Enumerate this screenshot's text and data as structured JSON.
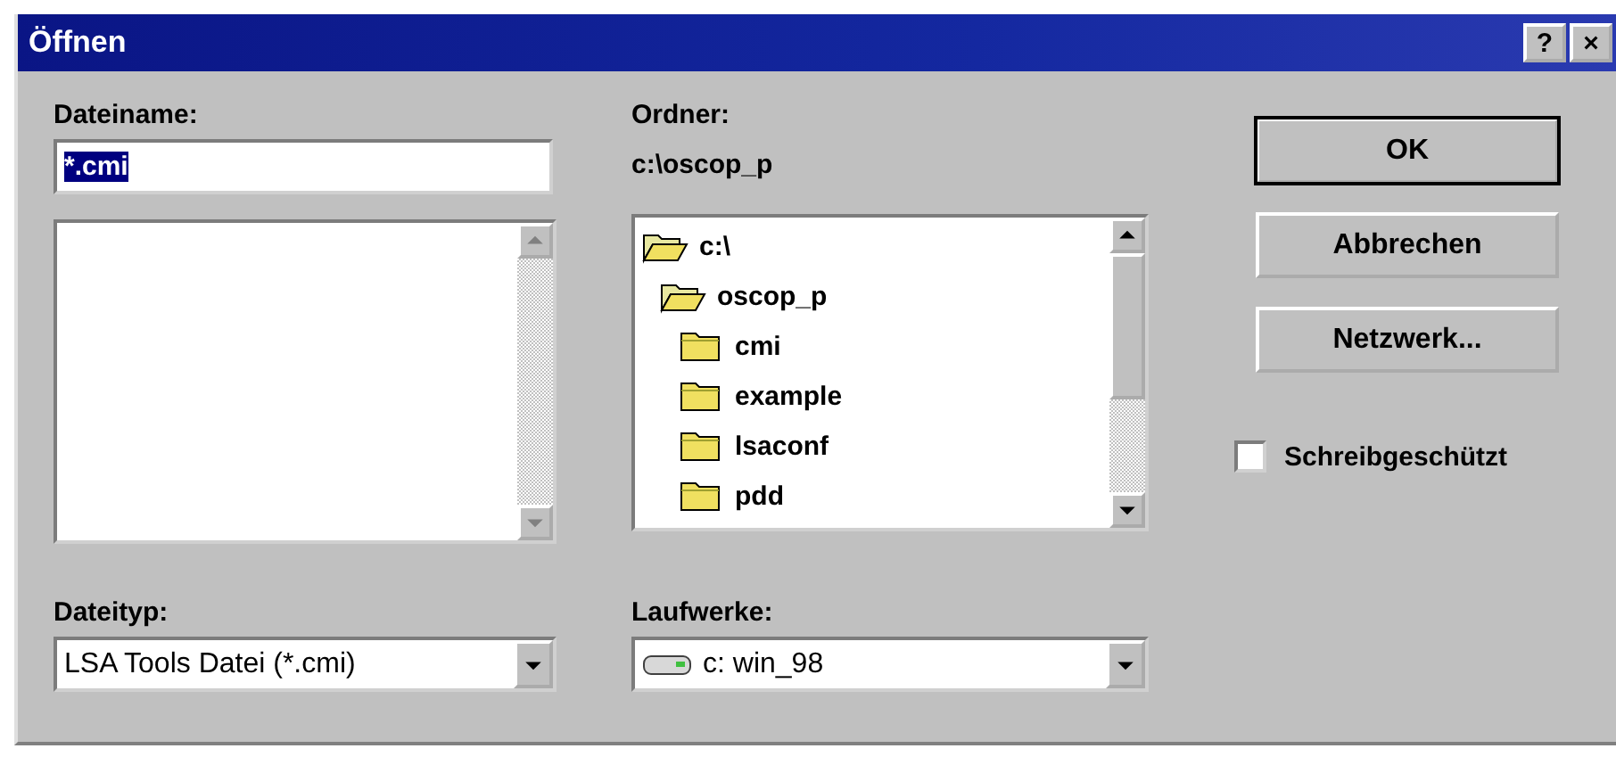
{
  "window": {
    "title": "Öffnen",
    "title_buttons": [
      "?",
      "×"
    ]
  },
  "filename": {
    "label": "Dateiname:",
    "value": "*.cmi",
    "value_selected": true
  },
  "folder": {
    "label": "Ordner:",
    "path": "c:\\oscop_p",
    "tree": [
      {
        "name": "c:\\",
        "expanded": true,
        "children": [
          {
            "name": "oscop_p",
            "expanded": true,
            "children": [
              {
                "name": "cmi",
                "expanded": false
              },
              {
                "name": "example",
                "expanded": false
              },
              {
                "name": "lsaconf",
                "expanded": false
              },
              {
                "name": "pdd",
                "expanded": false
              }
            ]
          }
        ]
      }
    ]
  },
  "filetype": {
    "label": "Dateityp:",
    "value": "LSA Tools Datei (*.cmi)"
  },
  "drives": {
    "label": "Laufwerke:",
    "value": "c: win_98"
  },
  "buttons": [
    {
      "label": "OK",
      "default": true
    },
    {
      "label": "Abbrechen",
      "default": false
    },
    {
      "label": "Netzwerk...",
      "default": false
    }
  ],
  "read_only": {
    "label": "Schreibgeschützt",
    "checked": false
  }
}
